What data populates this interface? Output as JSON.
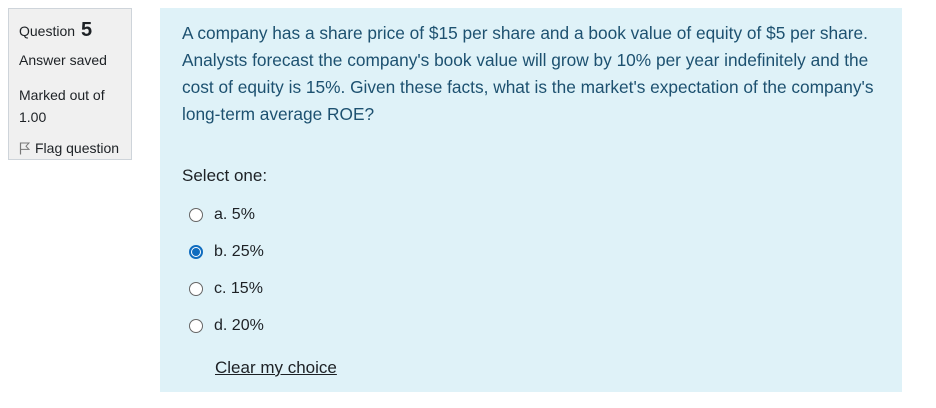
{
  "info": {
    "question_label": "Question",
    "question_number": "5",
    "state": "Answer saved",
    "marked_out_of": "Marked out of",
    "max_mark": "1.00",
    "flag_label": "Flag question"
  },
  "question": {
    "text": "A company has a share price of $15 per share and a book value of equity of $5 per share. Analysts forecast the company's book value will grow by 10% per year indefinitely and the cost of equity is 15%. Given these facts, what is the market's expectation of the company's long-term average ROE?",
    "prompt": "Select one:",
    "answers": [
      {
        "label": "a. 5%",
        "selected": false
      },
      {
        "label": "b. 25%",
        "selected": true
      },
      {
        "label": "c. 15%",
        "selected": false
      },
      {
        "label": "d. 20%",
        "selected": false
      }
    ],
    "clear_label": "Clear my choice"
  },
  "colors": {
    "accent": "#0f6cbf",
    "content_bg": "#dff2f8",
    "info_bg": "#f0f0f0"
  }
}
